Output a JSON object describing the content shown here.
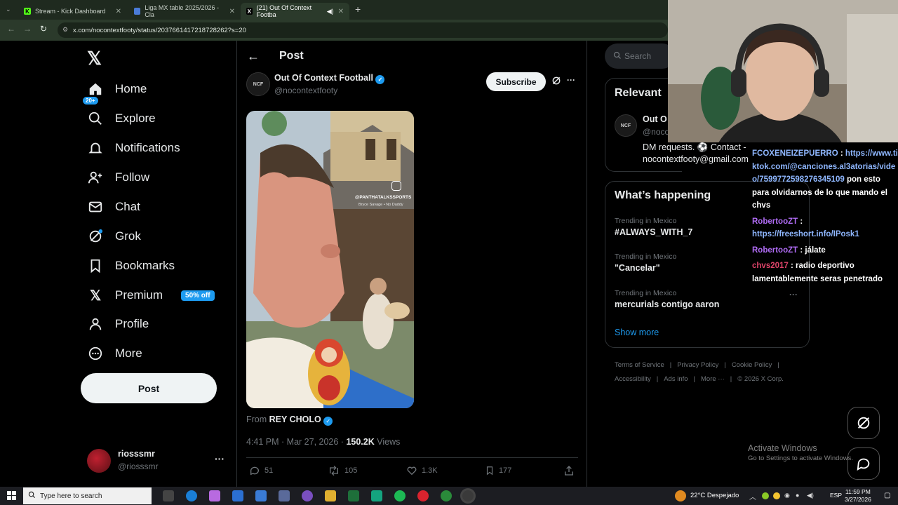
{
  "browser": {
    "tabs": [
      {
        "title": "Stream - Kick Dashboard",
        "icon": "kick-icon",
        "active": false
      },
      {
        "title": "Liga MX table 2025/2026 - Cla",
        "icon": "table-icon",
        "active": false
      },
      {
        "title": "(21) Out Of Context Footba",
        "icon": "x-icon",
        "active": true
      }
    ],
    "new_tab": "+",
    "url": "x.com/nocontextfooty/status/2037661417218728262?s=20"
  },
  "nav": {
    "items": [
      {
        "label": "Home",
        "icon": "home-icon"
      },
      {
        "label": "Explore",
        "icon": "search-icon"
      },
      {
        "label": "Notifications",
        "icon": "bell-icon"
      },
      {
        "label": "Follow",
        "icon": "follow-icon"
      },
      {
        "label": "Chat",
        "icon": "mail-icon"
      },
      {
        "label": "Grok",
        "icon": "grok-icon"
      },
      {
        "label": "Bookmarks",
        "icon": "bookmark-icon"
      },
      {
        "label": "Premium",
        "icon": "x-logo-icon"
      },
      {
        "label": "Profile",
        "icon": "profile-icon"
      },
      {
        "label": "More",
        "icon": "more-circle-icon"
      }
    ],
    "notifications_badge": "20+",
    "premium_promo": "50% off",
    "post_button": "Post",
    "account": {
      "name": "riosssmr",
      "handle": "@riosssmr"
    }
  },
  "post": {
    "header_title": "Post",
    "author_name": "Out Of Context Football",
    "author_handle": "@nocontextfooty",
    "subscribe_label": "Subscribe",
    "video_watermark": "@PANTHATALKSSPORTS",
    "video_watermark_sub": "Bryce Savage • No Daddy",
    "from_prefix": "From",
    "from_name": "REY CHOLO",
    "timestamp": "4:41 PM · Mar 27, 2026 ·",
    "views_count": "150.2K",
    "views_label": "Views",
    "replies": "51",
    "reposts": "105",
    "likes": "1.3K",
    "bookmarks": "177"
  },
  "sidebar": {
    "search_placeholder": "Search",
    "relevant_title": "Relevant",
    "relevant_name": "Out O",
    "relevant_handle": "@noco",
    "relevant_bio_1": "DM requests. ⚽ Contact -",
    "relevant_bio_2": "nocontextfooty@gmail.com",
    "happening_title": "What’s happening",
    "trends": [
      {
        "category": "Trending in Mexico",
        "name": "#ALWAYS_WITH_7"
      },
      {
        "category": "Trending in Mexico",
        "name": "\"Cancelar\""
      },
      {
        "category": "Trending in Mexico",
        "name": "mercurials contigo aaron"
      }
    ],
    "show_more": "Show more",
    "footer_row1": [
      "Terms of Service",
      "Privacy Policy",
      "Cookie Policy"
    ],
    "footer_row2": [
      "Accessibility",
      "Ads info",
      "More ···",
      "© 2026 X Corp."
    ]
  },
  "chat_overlay": {
    "msg1_name": "FCOXENEIZEPUERRO",
    "msg1_link": "https://www.tiktok.com/@canciones.al3atorias/video/7599772598276345109",
    "msg1_text": "pon esto para olvidarnos de lo que mando el chvs",
    "msg2_name": "RobertooZT",
    "msg2_link": "https://freeshort.info/IPosk1",
    "msg3_name": "RobertooZT",
    "msg3_text": "jálate",
    "msg4_name": "chvs2017",
    "msg4_text": "radio deportivo lamentablemente seras penetrado"
  },
  "activate": {
    "title": "Activate Windows",
    "subtitle": "Go to Settings to activate Windows."
  },
  "taskbar": {
    "search_placeholder": "Type here to search",
    "weather": "22°C  Despejado",
    "lang": "ESP",
    "time": "11:59 PM",
    "date": "3/27/2026"
  },
  "colors": {
    "accent": "#1d9bf0",
    "chat_name": "#b06cf5",
    "chat_link": "#8fb7ff"
  }
}
